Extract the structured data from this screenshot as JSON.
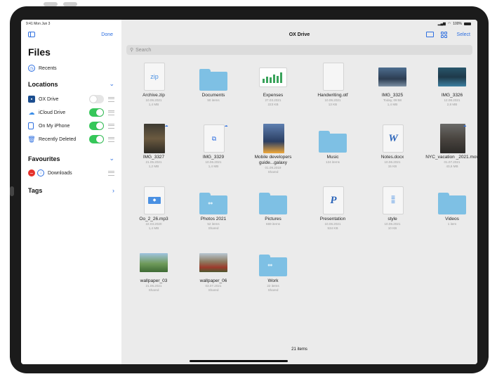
{
  "status": {
    "time": "9:41  Mon Jun 3",
    "battery": "100%"
  },
  "sidebar": {
    "done_label": "Done",
    "title": "Files",
    "recents": "Recents",
    "locations_heading": "Locations",
    "locations": [
      {
        "label": "OX Drive",
        "toggle": "off",
        "color": "#1c4e8f"
      },
      {
        "label": "iCloud Drive",
        "toggle": "on",
        "color": "#3b8ee8"
      },
      {
        "label": "On My iPhone",
        "toggle": "on",
        "color": "#2e6fe0"
      },
      {
        "label": "Recently Deleted",
        "toggle": "on",
        "color": "#2e6fe0"
      }
    ],
    "favourites_heading": "Favourites",
    "favourites": [
      {
        "label": "Downloads"
      }
    ],
    "tags_heading": "Tags"
  },
  "main": {
    "title": "OX Drive",
    "select_label": "Select",
    "search_placeholder": "Search",
    "footer": "21 items",
    "items": [
      {
        "name": "Archive.zip",
        "meta1": "10.06.2021",
        "meta2": "1,4 MB",
        "kind": "zip"
      },
      {
        "name": "Documents",
        "meta1": "50 items",
        "meta2": "",
        "kind": "folder"
      },
      {
        "name": "Expenses",
        "meta1": "27.03.2021",
        "meta2": "223 KB",
        "kind": "sheet"
      },
      {
        "name": "Handwriting.otf",
        "meta1": "10.06.2021",
        "meta2": "13 KB",
        "kind": "blank"
      },
      {
        "name": "IMG_3325",
        "meta1": "Today, 09:58",
        "meta2": "1,4 MB",
        "kind": "photo-mountain"
      },
      {
        "name": "IMG_3326",
        "meta1": "12.06.2021",
        "meta2": "2,8 MB",
        "kind": "photo-city"
      },
      {
        "name": "IMG_3327",
        "meta1": "21.05.2021",
        "meta2": "1,2 MB",
        "kind": "photo-portrait"
      },
      {
        "name": "IMG_3329",
        "meta1": "10.06.2021",
        "meta2": "1,4 MB",
        "kind": "copy"
      },
      {
        "name": "Mobile developers guide...galaxy",
        "meta1": "01.09.2019",
        "meta2": "Shared",
        "kind": "book"
      },
      {
        "name": "Music",
        "meta1": "124 items",
        "meta2": "",
        "kind": "folder"
      },
      {
        "name": "Notes.docx",
        "meta1": "10.06.2021",
        "meta2": "15 KB",
        "kind": "word"
      },
      {
        "name": "NYC_vacation _2021.mov",
        "meta1": "01.07.2021",
        "meta2": "43,6 MB",
        "kind": "photo-street"
      },
      {
        "name": "Oo_2_26.mp3",
        "meta1": "22.03.2020",
        "meta2": "1,4 MB",
        "kind": "audio"
      },
      {
        "name": "Photos 2021",
        "meta1": "52 items",
        "meta2": "Shared",
        "kind": "folder-shared"
      },
      {
        "name": "Pictures",
        "meta1": "669 items",
        "meta2": "",
        "kind": "folder"
      },
      {
        "name": "Presentation",
        "meta1": "10.06.2021",
        "meta2": "534 KB",
        "kind": "ppt"
      },
      {
        "name": "style",
        "meta1": "10.06.2021",
        "meta2": "10 KB",
        "kind": "text"
      },
      {
        "name": "Videos",
        "meta1": "1 item",
        "meta2": "",
        "kind": "folder"
      },
      {
        "name": "wallpaper_03",
        "meta1": "21.06.2021",
        "meta2": "Shared",
        "kind": "photo-valley"
      },
      {
        "name": "wallpaper_06",
        "meta1": "03.07.2021",
        "meta2": "Shared",
        "kind": "photo-flowers"
      },
      {
        "name": "Work",
        "meta1": "22 items",
        "meta2": "Shared",
        "kind": "folder-shared"
      }
    ]
  }
}
